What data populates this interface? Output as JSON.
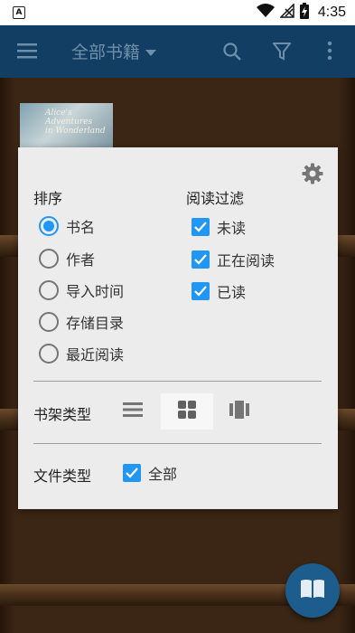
{
  "status_bar": {
    "time": "4:35",
    "app_icon_letter": "A"
  },
  "toolbar": {
    "title": "全部书籍"
  },
  "book": {
    "title_line1": "Alice's",
    "title_line2": "Adventures",
    "title_line3": "in Wonderland"
  },
  "dialog": {
    "sort": {
      "title": "排序",
      "options": [
        {
          "label": "书名",
          "selected": true
        },
        {
          "label": "作者",
          "selected": false
        },
        {
          "label": "导入时间",
          "selected": false
        },
        {
          "label": "存储目录",
          "selected": false
        },
        {
          "label": "最近阅读",
          "selected": false
        }
      ]
    },
    "read_filter": {
      "title": "阅读过滤",
      "options": [
        {
          "label": "未读",
          "checked": true
        },
        {
          "label": "正在阅读",
          "checked": true
        },
        {
          "label": "已读",
          "checked": true
        }
      ]
    },
    "shelf_type": {
      "label": "书架类型",
      "options": [
        "list-icon",
        "grid-icon",
        "cover-icon"
      ],
      "selected": "grid-icon"
    },
    "file_type": {
      "label": "文件类型",
      "option_label": "全部",
      "checked": true
    }
  },
  "colors": {
    "accent": "#2196f3",
    "toolbar": "#123e63",
    "fab": "#1c5d8e"
  }
}
